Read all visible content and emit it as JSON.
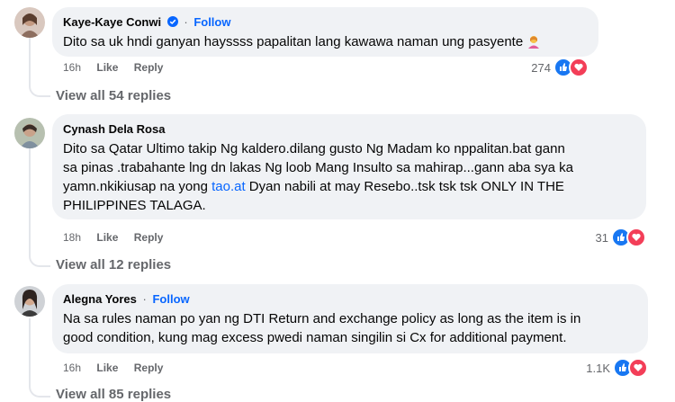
{
  "comments": [
    {
      "author": "Kaye-Kaye Conwi",
      "verified": true,
      "follow_label": "Follow",
      "text": "Dito sa uk hndi ganyan hayssss papalitan lang kawawa naman ung pasyente",
      "time": "16h",
      "like_label": "Like",
      "reply_label": "Reply",
      "reaction_count": "274",
      "reactions": [
        "like",
        "love"
      ],
      "view_replies": "View all 54 replies"
    },
    {
      "author": "Cynash Dela Rosa",
      "text_lines": [
        "Dito sa Qatar Ultimo takip Ng kaldero.dilang gusto Ng Madam ko nppalitan.bat gann",
        "sa pinas .trabahante lng dn lakas Ng loob Mang Insulto sa mahirap...gann aba sya ka",
        "yamn.nkikiusap na yong ",
        " Dyan nabili at may Resebo..tsk tsk tsk ONLY IN THE",
        "PHILIPPINES TALAGA."
      ],
      "link_text": "tao.at",
      "time": "18h",
      "like_label": "Like",
      "reply_label": "Reply",
      "reaction_count": "31",
      "reactions": [
        "like",
        "love"
      ],
      "view_replies": "View all 12 replies"
    },
    {
      "author": "Alegna Yores",
      "follow_label": "Follow",
      "text_lines": [
        "Na sa rules naman po yan ng DTI Return and exchange policy as long as the item is in",
        "good condition, kung mag excess pwedi naman singilin si Cx for additional payment."
      ],
      "time": "16h",
      "like_label": "Like",
      "reply_label": "Reply",
      "reaction_count": "1.1K",
      "reactions": [
        "like",
        "love"
      ],
      "view_replies": "View all 85 replies"
    }
  ],
  "colors": {
    "like": "#1877f2",
    "love": "#f33e58",
    "link": "#0866ff",
    "bubble": "#f0f2f5"
  }
}
